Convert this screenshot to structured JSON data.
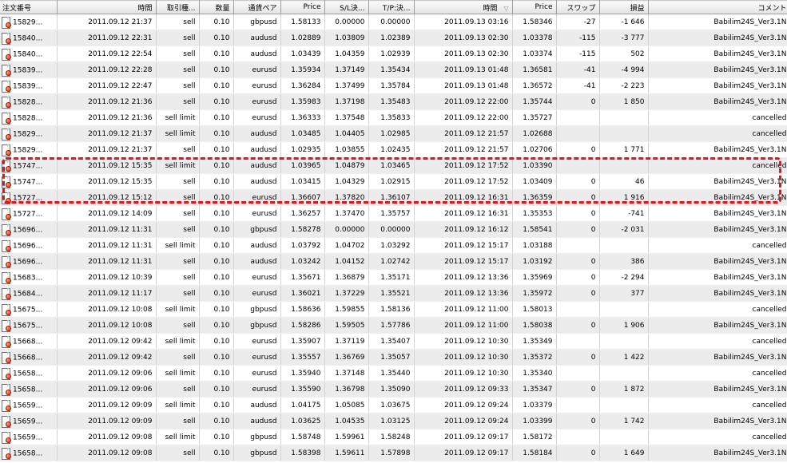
{
  "columns": [
    {
      "label": "注文番号",
      "align": "l",
      "width": 71
    },
    {
      "label": "時間",
      "align": "r",
      "width": 124
    },
    {
      "label": "取引種...",
      "align": "r",
      "width": 54
    },
    {
      "label": "数量",
      "align": "r",
      "width": 43
    },
    {
      "label": "通貨ペア",
      "align": "r",
      "width": 59
    },
    {
      "label": "Price",
      "align": "r",
      "width": 55
    },
    {
      "label": "S/L決...",
      "align": "r",
      "width": 55
    },
    {
      "label": "T/P:決...",
      "align": "r",
      "width": 57
    },
    {
      "label": "時間",
      "align": "r",
      "width": 123
    },
    {
      "label": "Price",
      "align": "r",
      "width": 55
    },
    {
      "label": "スワップ",
      "align": "r",
      "width": 54
    },
    {
      "label": "損益",
      "align": "r",
      "width": 61
    },
    {
      "label": "コメント",
      "align": "r",
      "width": 178
    }
  ],
  "sort_indicator": "▽",
  "rows": [
    [
      "15829...",
      "2011.09.12 21:37",
      "sell",
      "0.10",
      "gbpusd",
      "1.58133",
      "0.00000",
      "0.00000",
      "2011.09.13 03:16",
      "1.58346",
      "-27",
      "-1 646",
      "Babilim24S_Ver3.1N"
    ],
    [
      "15840...",
      "2011.09.12 22:31",
      "sell",
      "0.10",
      "audusd",
      "1.02889",
      "1.03809",
      "1.02389",
      "2011.09.13 02:30",
      "1.03378",
      "-115",
      "-3 777",
      "Babilim24S_Ver3.1N"
    ],
    [
      "15840...",
      "2011.09.12 22:54",
      "sell",
      "0.10",
      "audusd",
      "1.03439",
      "1.04359",
      "1.02939",
      "2011.09.13 02:30",
      "1.03374",
      "-115",
      "502",
      "Babilim24S_Ver3.1N"
    ],
    [
      "15839...",
      "2011.09.12 22:28",
      "sell",
      "0.10",
      "eurusd",
      "1.35934",
      "1.37149",
      "1.35434",
      "2011.09.13 01:48",
      "1.36581",
      "-41",
      "-4 994",
      "Babilim24S_Ver3.1N"
    ],
    [
      "15839...",
      "2011.09.12 22:47",
      "sell",
      "0.10",
      "eurusd",
      "1.36284",
      "1.37499",
      "1.35784",
      "2011.09.13 01:48",
      "1.36572",
      "-41",
      "-2 223",
      "Babilim24S_Ver3.1N"
    ],
    [
      "15828...",
      "2011.09.12 21:36",
      "sell",
      "0.10",
      "eurusd",
      "1.35983",
      "1.37198",
      "1.35483",
      "2011.09.12 22:00",
      "1.35744",
      "0",
      "1 850",
      "Babilim24S_Ver3.1N"
    ],
    [
      "15828...",
      "2011.09.12 21:36",
      "sell limit",
      "0.10",
      "eurusd",
      "1.36333",
      "1.37548",
      "1.35833",
      "2011.09.12 22:00",
      "1.35727",
      "",
      "",
      "cancelled"
    ],
    [
      "15829...",
      "2011.09.12 21:37",
      "sell limit",
      "0.10",
      "audusd",
      "1.03485",
      "1.04405",
      "1.02985",
      "2011.09.12 21:57",
      "1.02688",
      "",
      "",
      "cancelled"
    ],
    [
      "15829...",
      "2011.09.12 21:37",
      "sell",
      "0.10",
      "audusd",
      "1.02935",
      "1.03855",
      "1.02435",
      "2011.09.12 21:57",
      "1.02706",
      "0",
      "1 771",
      "Babilim24S_Ver3.1N"
    ],
    [
      "15747...",
      "2011.09.12 15:35",
      "sell limit",
      "0.10",
      "audusd",
      "1.03965",
      "1.04879",
      "1.03465",
      "2011.09.12 17:52",
      "1.03390",
      "",
      "",
      "cancelled"
    ],
    [
      "15747...",
      "2011.09.12 15:35",
      "sell",
      "0.10",
      "audusd",
      "1.03415",
      "1.04329",
      "1.02915",
      "2011.09.12 17:52",
      "1.03409",
      "0",
      "46",
      "Babilim24S_Ver3.1N"
    ],
    [
      "15727...",
      "2011.09.12 15:12",
      "sell",
      "0.10",
      "eurusd",
      "1.36607",
      "1.37820",
      "1.36107",
      "2011.09.12 16:31",
      "1.36359",
      "0",
      "1 916",
      "Babilim24S_Ver3.1N"
    ],
    [
      "15727...",
      "2011.09.12 14:09",
      "sell",
      "0.10",
      "eurusd",
      "1.36257",
      "1.37470",
      "1.35757",
      "2011.09.12 16:31",
      "1.35353",
      "0",
      "-741",
      "Babilim24S_Ver3.1N"
    ],
    [
      "15696...",
      "2011.09.12 11:31",
      "sell",
      "0.10",
      "gbpusd",
      "1.58278",
      "0.00000",
      "0.00000",
      "2011.09.12 16:12",
      "1.58541",
      "0",
      "-2 031",
      "Babilim24S_Ver3.1N"
    ],
    [
      "15696...",
      "2011.09.12 11:31",
      "sell limit",
      "0.10",
      "audusd",
      "1.03792",
      "1.04702",
      "1.03292",
      "2011.09.12 15:17",
      "1.03188",
      "",
      "",
      "cancelled"
    ],
    [
      "15696...",
      "2011.09.12 11:31",
      "sell",
      "0.10",
      "audusd",
      "1.03242",
      "1.04152",
      "1.02742",
      "2011.09.12 15:17",
      "1.03192",
      "0",
      "386",
      "Babilim24S_Ver3.1N"
    ],
    [
      "15683...",
      "2011.09.12 10:39",
      "sell",
      "0.10",
      "eurusd",
      "1.35671",
      "1.36879",
      "1.35171",
      "2011.09.12 13:36",
      "1.35969",
      "0",
      "-2 294",
      "Babilim24S_Ver3.1N"
    ],
    [
      "15684...",
      "2011.09.12 11:17",
      "sell",
      "0.10",
      "eurusd",
      "1.36021",
      "1.37229",
      "1.35521",
      "2011.09.12 13:36",
      "1.35972",
      "0",
      "377",
      "Babilim24S_Ver3.1N"
    ],
    [
      "15675...",
      "2011.09.12 10:08",
      "sell limit",
      "0.10",
      "gbpusd",
      "1.58636",
      "1.59855",
      "1.58136",
      "2011.09.12 11:00",
      "1.58013",
      "",
      "",
      "cancelled"
    ],
    [
      "15675...",
      "2011.09.12 10:08",
      "sell",
      "0.10",
      "gbpusd",
      "1.58286",
      "1.59505",
      "1.57786",
      "2011.09.12 11:00",
      "1.58038",
      "0",
      "1 906",
      "Babilim24S_Ver3.1N"
    ],
    [
      "15668...",
      "2011.09.12 09:42",
      "sell limit",
      "0.10",
      "eurusd",
      "1.35907",
      "1.37119",
      "1.35407",
      "2011.09.12 10:30",
      "1.35349",
      "",
      "",
      "cancelled"
    ],
    [
      "15668...",
      "2011.09.12 09:42",
      "sell",
      "0.10",
      "eurusd",
      "1.35557",
      "1.36769",
      "1.35057",
      "2011.09.12 10:30",
      "1.35372",
      "0",
      "1 422",
      "Babilim24S_Ver3.1N"
    ],
    [
      "15658...",
      "2011.09.12 09:06",
      "sell limit",
      "0.10",
      "eurusd",
      "1.35940",
      "1.37148",
      "1.35440",
      "2011.09.12 10:30",
      "1.35340",
      "",
      "",
      "cancelled"
    ],
    [
      "15658...",
      "2011.09.12 09:06",
      "sell",
      "0.10",
      "eurusd",
      "1.35590",
      "1.36798",
      "1.35090",
      "2011.09.12 09:33",
      "1.35347",
      "0",
      "1 872",
      "Babilim24S_Ver3.1N"
    ],
    [
      "15659...",
      "2011.09.12 09:09",
      "sell limit",
      "0.10",
      "audusd",
      "1.04175",
      "1.05085",
      "1.03675",
      "2011.09.12 09:24",
      "1.03379",
      "",
      "",
      "cancelled"
    ],
    [
      "15659...",
      "2011.09.12 09:09",
      "sell",
      "0.10",
      "audusd",
      "1.03625",
      "1.04535",
      "1.03125",
      "2011.09.12 09:24",
      "1.03399",
      "0",
      "1 742",
      "Babilim24S_Ver3.1N"
    ],
    [
      "15659...",
      "2011.09.12 09:08",
      "sell limit",
      "0.10",
      "gbpusd",
      "1.58748",
      "1.59961",
      "1.58248",
      "2011.09.12 09:17",
      "1.58172",
      "",
      "",
      "cancelled"
    ],
    [
      "15658...",
      "2011.09.12 09:08",
      "sell",
      "0.10",
      "gbpusd",
      "1.58398",
      "1.59611",
      "1.57898",
      "2011.09.12 09:17",
      "1.58184",
      "0",
      "1 649",
      "Babilim24S_Ver3.1N"
    ]
  ],
  "colors": {
    "highlight_border": "#e0141b",
    "row_alt": "#ececec",
    "icon_dot": "#d8300f"
  },
  "icons": {
    "row_icon": "order-document-icon"
  }
}
